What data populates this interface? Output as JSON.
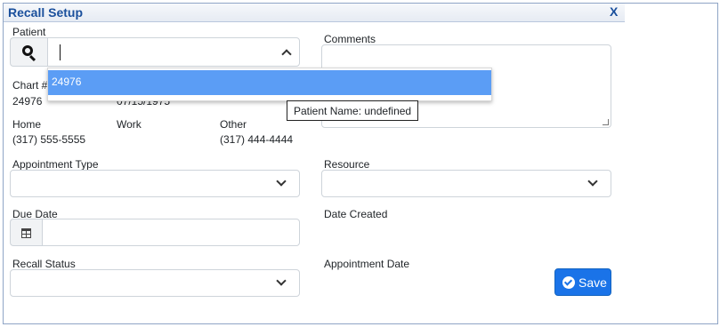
{
  "window": {
    "title": "Recall Setup",
    "close_glyph": "X"
  },
  "patient": {
    "label": "Patient",
    "input_value": "",
    "dropdown_option": "24976",
    "tooltip": "Patient Name: undefined"
  },
  "chart": {
    "label": "Chart #",
    "value": "24976",
    "partial_text": "07/15/1975"
  },
  "phones": {
    "home_label": "Home",
    "home_value": "(317) 555-5555",
    "work_label": "Work",
    "work_value": "",
    "other_label": "Other",
    "other_value": "(317) 444-4444"
  },
  "comments": {
    "label": "Comments",
    "value": ""
  },
  "appointment_type": {
    "label": "Appointment Type",
    "value": ""
  },
  "resource": {
    "label": "Resource",
    "value": ""
  },
  "due_date": {
    "label": "Due Date",
    "value": ""
  },
  "date_created": {
    "label": "Date Created",
    "value": ""
  },
  "recall_status": {
    "label": "Recall Status",
    "value": ""
  },
  "appointment_date": {
    "label": "Appointment Date",
    "value": ""
  },
  "save_button": {
    "label": "Save"
  },
  "colors": {
    "accent": "#1a73e8",
    "title": "#1a4f9c",
    "highlight": "#5b9df5"
  },
  "icons": [
    "search-icon",
    "chevron-up-icon",
    "chevron-down-icon",
    "calendar-icon",
    "check-circle-icon",
    "close-icon"
  ]
}
